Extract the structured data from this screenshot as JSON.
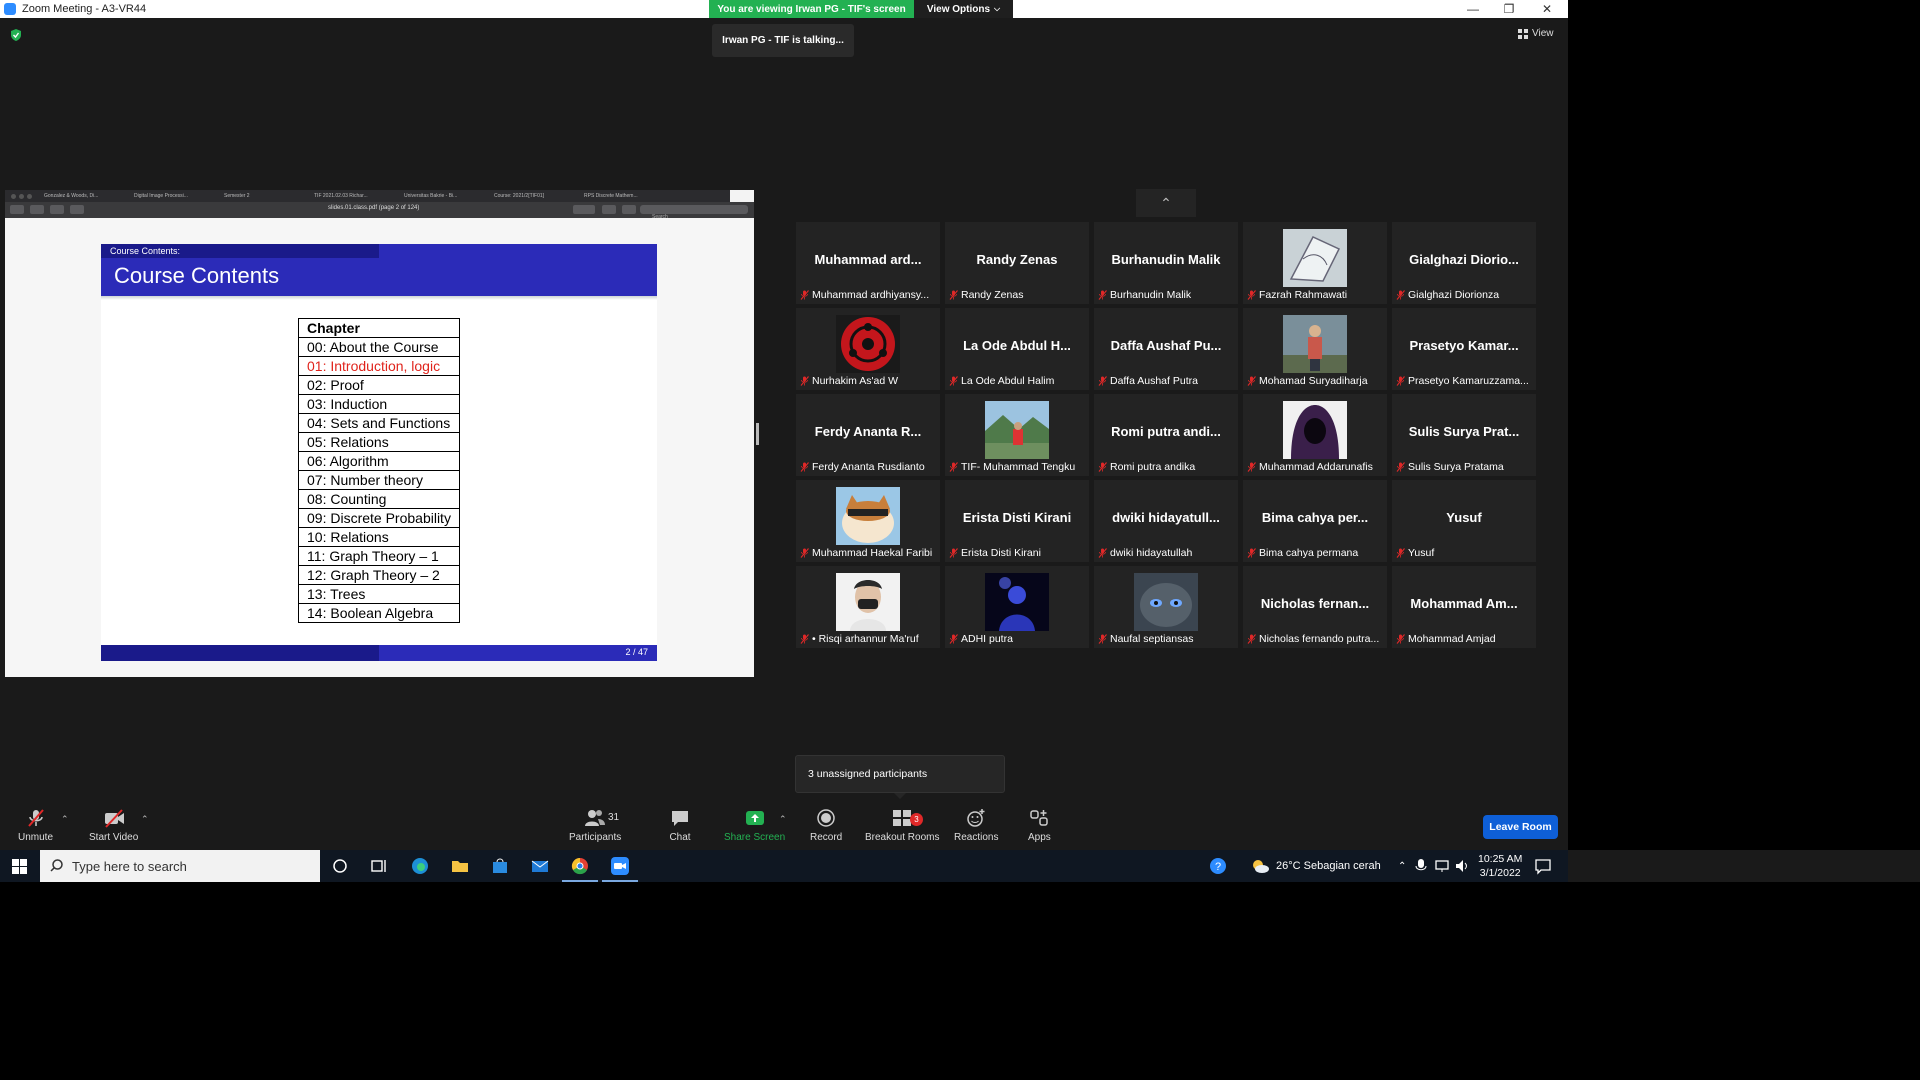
{
  "window": {
    "title": "Zoom Meeting - A3-VR44"
  },
  "banner": {
    "viewing": "You are viewing Irwan PG - TIF's screen",
    "view_options": "View Options"
  },
  "talking": "Irwan PG - TIF is talking...",
  "view_label": "View",
  "share": {
    "browser_tabs": [
      "Gonzalez & Woods, Di...",
      "Digital Image Processi...",
      "Semester 2",
      "TIF 2021.02.03 Richar...",
      "Universitas Bakrie - Bi...",
      "Course: 2021/2[TIF01]",
      "RPS Discrete Mathem..."
    ],
    "pdf_title": "slides.01.class.pdf (page 2 of 124)",
    "search_placeholder": "Search",
    "slide": {
      "section": "Course Contents:",
      "title": "Course Contents",
      "table_header": "Chapter",
      "chapters": [
        "00: About the Course",
        "01: Introduction, logic",
        "02: Proof",
        "03: Induction",
        "04: Sets and Functions",
        "05: Relations",
        "06: Algorithm",
        "07: Number theory",
        "08: Counting",
        "09: Discrete Probability",
        "10: Relations",
        "11: Graph Theory – 1",
        "12: Graph Theory – 2",
        "13: Trees",
        "14: Boolean Algebra"
      ],
      "highlighted_index": 1,
      "page": "2 / 47"
    }
  },
  "participants": [
    {
      "big": "Muhammad  ard...",
      "name": "Muhammad ardhiyansy..."
    },
    {
      "big": "Randy Zenas",
      "name": "Randy Zenas"
    },
    {
      "big": "Burhanudin Malik",
      "name": "Burhanudin Malik"
    },
    {
      "big": "",
      "name": "Fazrah Rahmawati",
      "photo": "sketch"
    },
    {
      "big": "Gialghazi  Diorio...",
      "name": "Gialghazi Diorionza"
    },
    {
      "big": "",
      "name": "Nurhakim As'ad W",
      "photo": "sharingan"
    },
    {
      "big": "La Ode Abdul H...",
      "name": "La Ode Abdul Halim"
    },
    {
      "big": "Daffa Aushaf Pu...",
      "name": "Daffa Aushaf Putra"
    },
    {
      "big": "",
      "name": "Mohamad Suryadiharja",
      "photo": "person"
    },
    {
      "big": "Prasetyo  Kamar...",
      "name": "Prasetyo Kamaruzzama..."
    },
    {
      "big": "Ferdy Ananta R...",
      "name": "Ferdy Ananta Rusdianto"
    },
    {
      "big": "",
      "name": "TIF- Muhammad Tengku",
      "photo": "landscape"
    },
    {
      "big": "Romi putra andi...",
      "name": "Romi putra andika"
    },
    {
      "big": "",
      "name": "Muhammad Addarunafis",
      "photo": "hood"
    },
    {
      "big": "Sulis Surya  Prat...",
      "name": "Sulis Surya Pratama"
    },
    {
      "big": "",
      "name": "Muhammad Haekal Faribi",
      "photo": "cat"
    },
    {
      "big": "Erista Disti Kirani",
      "name": "Erista Disti Kirani"
    },
    {
      "big": "dwiki  hidayatull...",
      "name": "dwiki hidayatullah"
    },
    {
      "big": "Bima  cahya  per...",
      "name": "Bima cahya permana"
    },
    {
      "big": "Yusuf",
      "name": "Yusuf"
    },
    {
      "big": "",
      "name": "• Risqi arhannur Ma'ruf",
      "photo": "mask"
    },
    {
      "big": "",
      "name": "ADHI putra",
      "photo": "blue"
    },
    {
      "big": "",
      "name": "Naufal septiansas",
      "photo": "darkcat"
    },
    {
      "big": "Nicholas  fernan...",
      "name": "Nicholas fernando putra..."
    },
    {
      "big": "Mohammad  Am...",
      "name": "Mohammad Amjad"
    }
  ],
  "unassigned": "3 unassigned participants",
  "toolbar": {
    "unmute": "Unmute",
    "start_video": "Start Video",
    "participants": "Participants",
    "participants_count": "31",
    "chat": "Chat",
    "share_screen": "Share Screen",
    "record": "Record",
    "breakout_rooms": "Breakout Rooms",
    "breakout_badge": "3",
    "reactions": "Reactions",
    "apps": "Apps",
    "leave": "Leave Room"
  },
  "taskbar": {
    "search_placeholder": "Type here to search",
    "weather": "26°C  Sebagian cerah",
    "time": "10:25 AM",
    "date": "3/1/2022"
  },
  "colors": {
    "zoom_green": "#23b152",
    "leave_blue": "#0e5fd7",
    "beamer_blue": "#2b2bb8",
    "muted_red": "#e02828"
  }
}
